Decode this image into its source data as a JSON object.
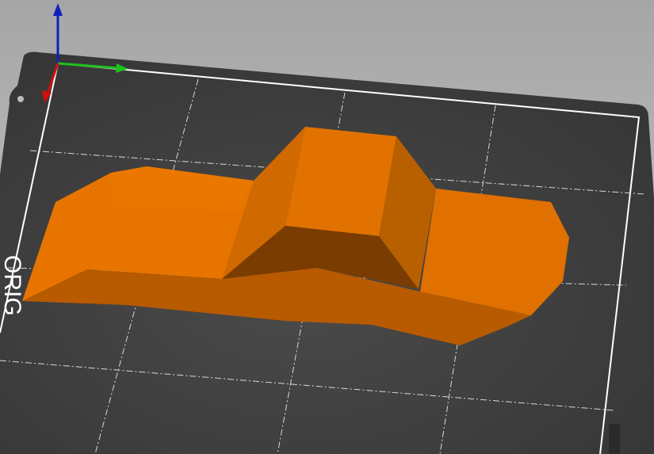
{
  "viewport": {
    "bed_label": "ORIG",
    "colors": {
      "background_top": "#a9a9a9",
      "background_bottom": "#c8c8c8",
      "bed": "#3c3c3c",
      "bed_border": "#ffffff",
      "model": "#e07000",
      "axis_x": "#1fbf1f",
      "axis_y": "#d01010",
      "axis_z": "#1020c0"
    }
  }
}
